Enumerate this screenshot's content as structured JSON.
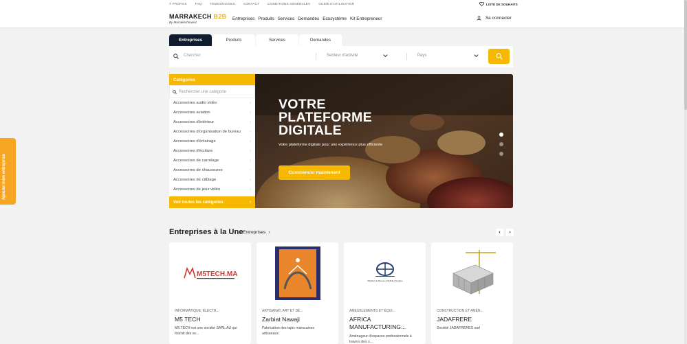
{
  "topbar": {
    "links": [
      "À PROPOS",
      "FAQ",
      "TÉMOIGNAGES",
      "CONTACT",
      "CONDITIONS GÉNÉRALES",
      "GUIDE D'UTILISATION"
    ],
    "wishlist": "LISTE DE SOUHAITS"
  },
  "header": {
    "logo_main": "MARRAKECH",
    "logo_accent": "B2B",
    "logo_sub": "By MarrakechInvest",
    "nav": [
      "Entreprises",
      "Produits",
      "Services",
      "Demandes",
      "Ecosystème",
      "Kit Entrepreneur"
    ],
    "login": "Se connecter"
  },
  "tabs": [
    "Entreprises",
    "Produits",
    "Services",
    "Demandes"
  ],
  "search": {
    "placeholder": "Chercher",
    "sector_placeholder": "Secteur d'activité",
    "country_placeholder": "Pays"
  },
  "categories": {
    "title": "Catégories",
    "search_placeholder": "Rechercher une catégorie",
    "items": [
      "Accessoires audio vidéo",
      "Accessoires aviation",
      "Accessoires d'intérieur",
      "Accessoires d'organisation de bureau",
      "Accessoires d'éclairage",
      "Accessoires d'écriture",
      "Accessoires de carrelage",
      "Accessoires de chaussures",
      "Accessoires de câblage",
      "Accessoires de jeux vidéo"
    ],
    "all_label": "Voir toutes les catégories"
  },
  "hero": {
    "title": "VOTRE PLATEFORME DIGITALE",
    "subtitle": "Votre plateforme digitale pour une expérience plus efficiente",
    "cta": "Commencer maintenant",
    "slides": 3,
    "active_slide": 1
  },
  "side_tab": "Ajouter mon entreprise",
  "featured": {
    "title": "Entreprises à la Une",
    "link": "Entreprises",
    "cards": [
      {
        "category": "INFORMATIQUE, ÉLECTR...",
        "name": "M5 TECH",
        "desc": "M5 TECH est une société SARL AU qui fournit des se...",
        "logo_text": "M5TECH.MA"
      },
      {
        "category": "ARTISANAT, ART ET DÉ...",
        "name": "Zarbiat Nawaji",
        "desc": "Fabrication des tapis marocaines artisanaux",
        "logo_text": ""
      },
      {
        "category": "AMEUBLEMENTS ET ÉQUI...",
        "name": "AFRICA MANUFACTURING...",
        "desc": "Aménageur d'espaces professionnels à travers des s...",
        "logo_text": "Mobilier de Bureau & Mobilier Scolaire"
      },
      {
        "category": "CONSTRUCTION ET AMÉN...",
        "name": "JADAFRERE",
        "desc": "Société JADAFRERES sarl",
        "logo_text": ""
      }
    ]
  },
  "colors": {
    "accent": "#f6b800",
    "dark": "#0f1b2e",
    "side_tab": "#f6a623"
  }
}
